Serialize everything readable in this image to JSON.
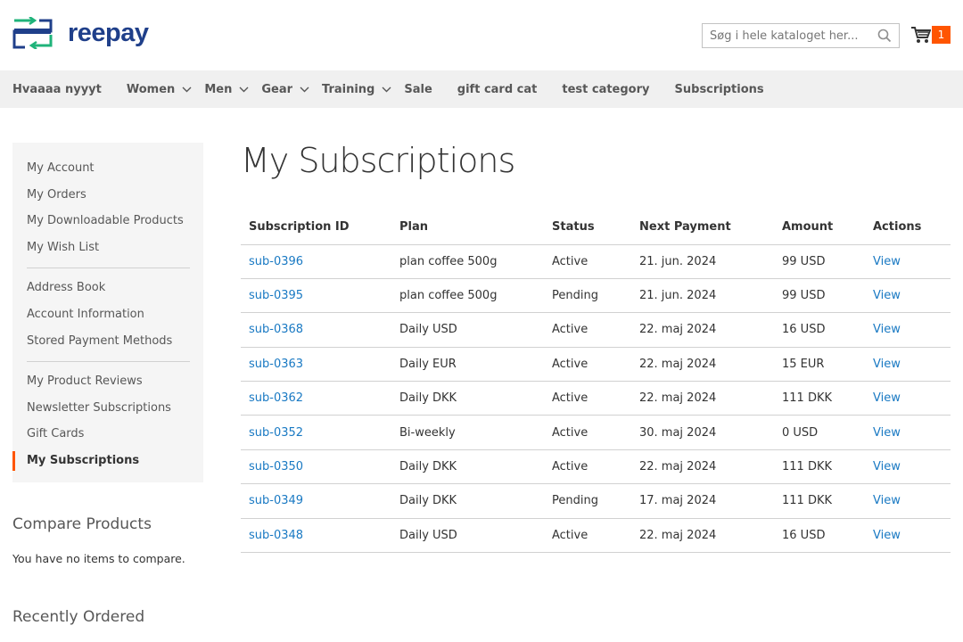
{
  "header": {
    "logo_text": "reepay",
    "search_placeholder": "Søg i hele kataloget her...",
    "cart_count": "1",
    "colors": {
      "brand_blue": "#1f3f8a",
      "brand_green": "#1fb37a",
      "accent": "#ff5501",
      "link": "#1979c3"
    }
  },
  "nav": {
    "items": [
      {
        "label": "Hvaaaa nyyyt",
        "dropdown": false
      },
      {
        "label": "Women",
        "dropdown": true
      },
      {
        "label": "Men",
        "dropdown": true
      },
      {
        "label": "Gear",
        "dropdown": true
      },
      {
        "label": "Training",
        "dropdown": true
      },
      {
        "label": "Sale",
        "dropdown": false
      },
      {
        "label": "gift card cat",
        "dropdown": false
      },
      {
        "label": "test category",
        "dropdown": false
      },
      {
        "label": "Subscriptions",
        "dropdown": false
      }
    ]
  },
  "sidebar": {
    "groups": [
      [
        "My Account",
        "My Orders",
        "My Downloadable Products",
        "My Wish List"
      ],
      [
        "Address Book",
        "Account Information",
        "Stored Payment Methods"
      ],
      [
        "My Product Reviews",
        "Newsletter Subscriptions",
        "Gift Cards",
        "My Subscriptions"
      ]
    ],
    "active": "My Subscriptions"
  },
  "compare": {
    "title": "Compare Products",
    "text": "You have no items to compare."
  },
  "recent": {
    "title": "Recently Ordered"
  },
  "main": {
    "title": "My Subscriptions",
    "columns": [
      "Subscription ID",
      "Plan",
      "Status",
      "Next Payment",
      "Amount",
      "Actions"
    ],
    "rows": [
      {
        "id": "sub-0396",
        "plan": "plan coffee 500g",
        "status": "Active",
        "next": "21. jun. 2024",
        "amount": "99 USD",
        "action": "View"
      },
      {
        "id": "sub-0395",
        "plan": "plan coffee 500g",
        "status": "Pending",
        "next": "21. jun. 2024",
        "amount": "99 USD",
        "action": "View"
      },
      {
        "id": "sub-0368",
        "plan": "Daily USD",
        "status": "Active",
        "next": "22. maj 2024",
        "amount": "16 USD",
        "action": "View"
      },
      {
        "id": "sub-0363",
        "plan": "Daily EUR",
        "status": "Active",
        "next": "22. maj 2024",
        "amount": "15 EUR",
        "action": "View"
      },
      {
        "id": "sub-0362",
        "plan": "Daily DKK",
        "status": "Active",
        "next": "22. maj 2024",
        "amount": "111 DKK",
        "action": "View"
      },
      {
        "id": "sub-0352",
        "plan": "Bi-weekly",
        "status": "Active",
        "next": "30. maj 2024",
        "amount": "0 USD",
        "action": "View"
      },
      {
        "id": "sub-0350",
        "plan": "Daily DKK",
        "status": "Active",
        "next": "22. maj 2024",
        "amount": "111 DKK",
        "action": "View"
      },
      {
        "id": "sub-0349",
        "plan": "Daily DKK",
        "status": "Pending",
        "next": "17. maj 2024",
        "amount": "111 DKK",
        "action": "View"
      },
      {
        "id": "sub-0348",
        "plan": "Daily USD",
        "status": "Active",
        "next": "22. maj 2024",
        "amount": "16 USD",
        "action": "View"
      }
    ]
  }
}
